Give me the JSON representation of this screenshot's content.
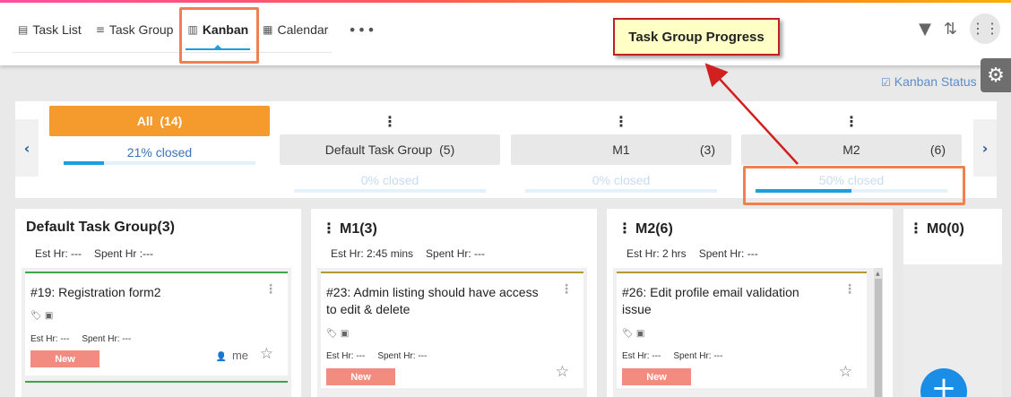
{
  "tabs": [
    {
      "label": "Task List",
      "icon": "list-icon"
    },
    {
      "label": "Task Group",
      "icon": "task-group-icon"
    },
    {
      "label": "Kanban",
      "icon": "kanban-icon",
      "active": true
    },
    {
      "label": "Calendar",
      "icon": "calendar-icon"
    }
  ],
  "more_label": "•••",
  "callout": {
    "text": "Task Group Progress"
  },
  "kanban_status": {
    "label": "Kanban Status"
  },
  "groups": [
    {
      "name": "All",
      "count": "(14)",
      "closed": "21% closed",
      "progress": 0.21,
      "active": true
    },
    {
      "name": "Default Task Group",
      "count": "(5)",
      "closed": "0% closed",
      "progress": 0
    },
    {
      "name": "M1",
      "count": "(3)",
      "closed": "0% closed",
      "progress": 0
    },
    {
      "name": "M2",
      "count": "(6)",
      "closed": "50% closed",
      "progress": 0.5
    }
  ],
  "columns": [
    {
      "title": "Default Task Group(3)",
      "est": "Est Hr: ---",
      "spent": "Spent Hr :---",
      "card": {
        "title": "#19: Registration form2",
        "est": "Est Hr: ---",
        "spent": "Spent Hr: ---",
        "status": "New",
        "owner": "me"
      }
    },
    {
      "title": "M1(3)",
      "est": "Est Hr: 2:45 mins",
      "spent": "Spent Hr: ---",
      "card": {
        "title": "#23: Admin listing should have access to edit & delete",
        "est": "Est Hr: ---",
        "spent": "Spent Hr: ---",
        "status": "New"
      }
    },
    {
      "title": "M2(6)",
      "est": "Est Hr: 2 hrs",
      "spent": "Spent Hr: ---",
      "card": {
        "title": "#26: Edit profile email validation issue",
        "est": "Est Hr: ---",
        "spent": "Spent Hr: ---",
        "status": "New"
      }
    },
    {
      "title": "M0(0)"
    }
  ],
  "fab_label": "+",
  "colors": {
    "accent": "#1a9fe0",
    "all_group": "#f59a2c",
    "highlight": "#f0804f",
    "callout_border": "#c41d24",
    "status_new": "#f28c81"
  }
}
